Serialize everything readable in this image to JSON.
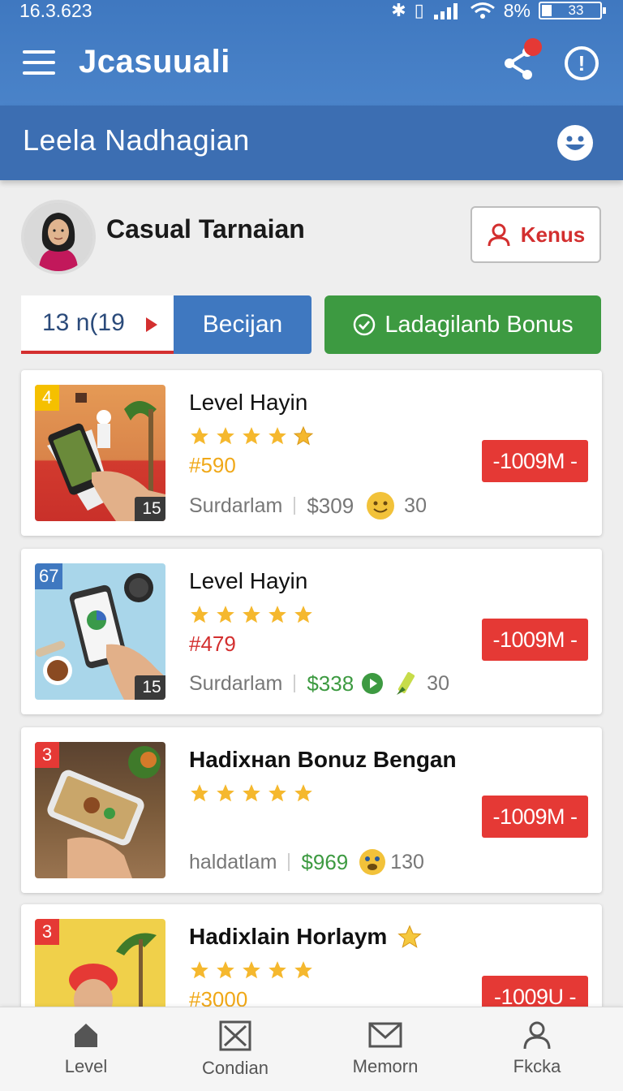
{
  "status_bar": {
    "time": "16.3.623",
    "battery_percent": "8%",
    "battery_label": "33"
  },
  "app_bar": {
    "title": "Jcasuuali"
  },
  "sub_bar": {
    "title": "Leela Nadhagian"
  },
  "profile": {
    "name": "Casual Tarnaian",
    "action_label": "Kenus"
  },
  "tabs": {
    "count_label": "13 n(19",
    "blue_label": "Becijan",
    "green_label": "Ladagilanb Bonus"
  },
  "colors": {
    "primary": "#3f78c0",
    "accent_red": "#e53935",
    "accent_green": "#3d9a41",
    "star": "#f5b82e"
  },
  "cards": [
    {
      "badge": "4",
      "thumb_count": "15",
      "title": "Level Hayin",
      "stars": 5,
      "code": "#590",
      "meta_label": "Surdarlam",
      "price": "$309",
      "count": "30",
      "tag": "-1009M -"
    },
    {
      "badge": "67",
      "thumb_count": "15",
      "title": "Level Hayin",
      "stars": 5,
      "code": "#479",
      "meta_label": "Surdarlam",
      "price": "$338",
      "count": "30",
      "tag": "-1009M -"
    },
    {
      "badge": "3",
      "title": "Hadixнan Bonuz Bengan",
      "stars": 5,
      "meta_label": "haldatlam",
      "price": "$969",
      "count": "130",
      "tag": "-1009M -"
    },
    {
      "badge": "3",
      "title": "Hadixlain Horlaym",
      "stars": 5,
      "code": "#3000",
      "tag": "-1009U -"
    }
  ],
  "bottom_nav": [
    {
      "label": "Level",
      "icon": "home-icon"
    },
    {
      "label": "Condian",
      "icon": "close-box-icon"
    },
    {
      "label": "Memorn",
      "icon": "mail-icon"
    },
    {
      "label": "Fkcka",
      "icon": "person-icon"
    }
  ]
}
